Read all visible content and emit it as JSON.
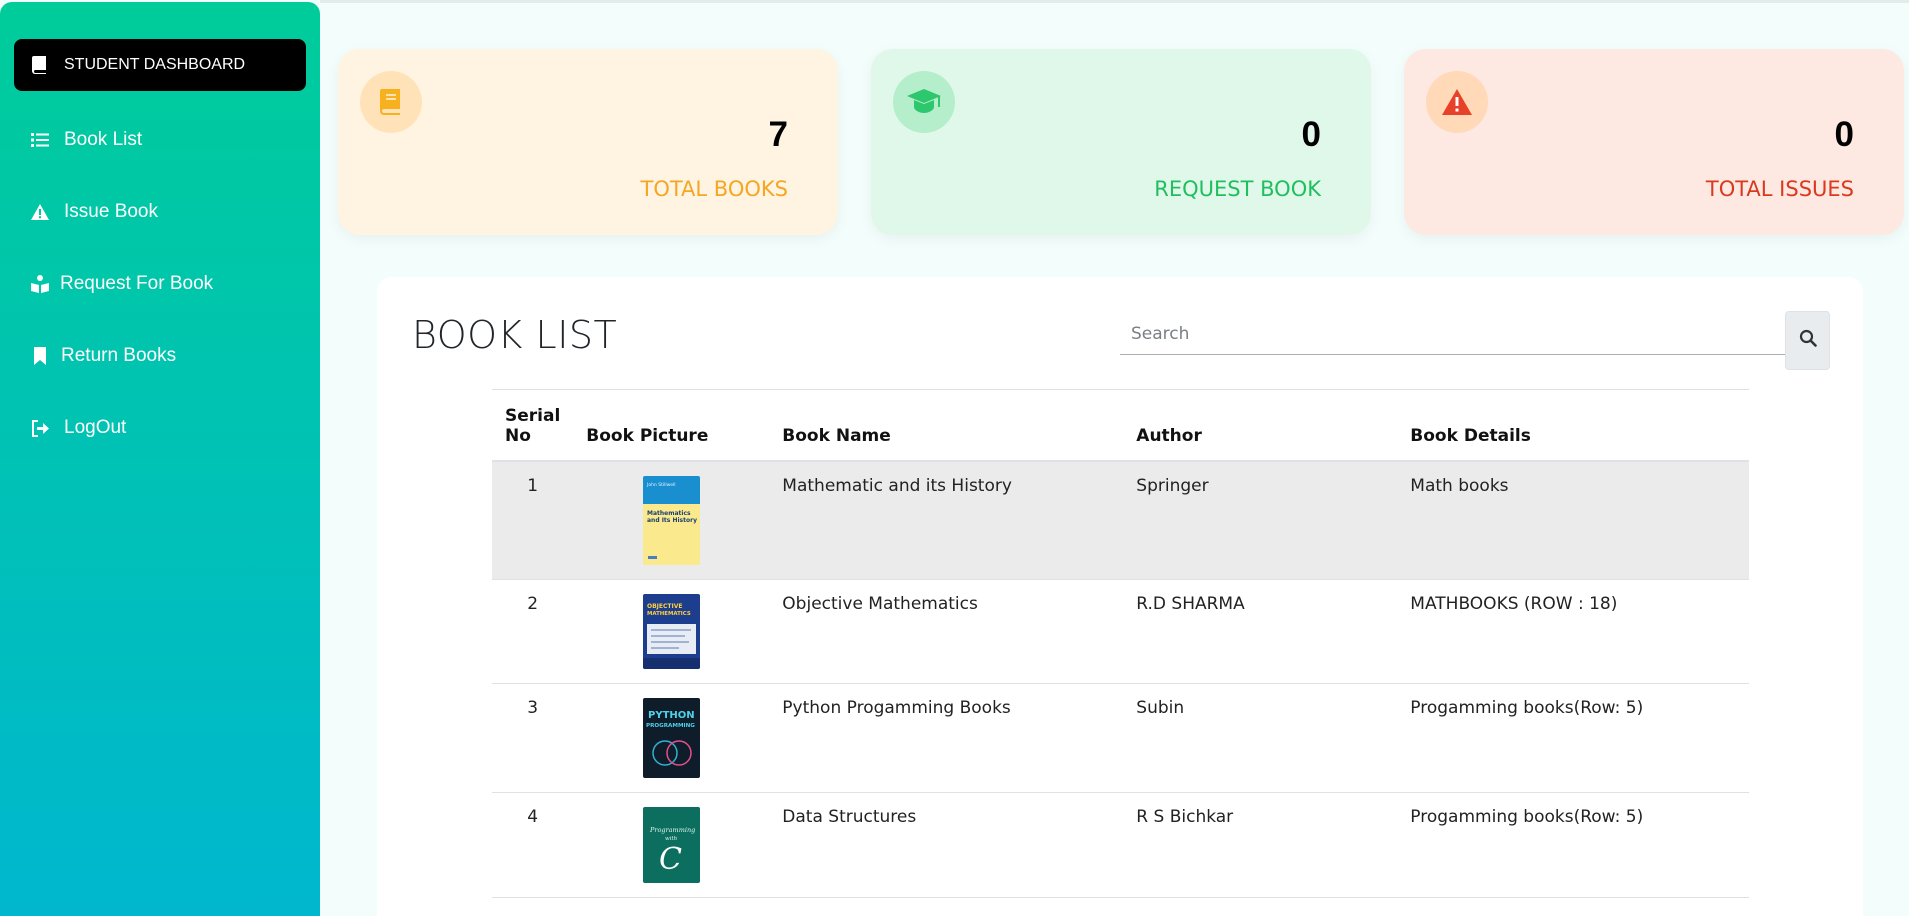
{
  "sidebar": {
    "dashboard_label": "STUDENT DASHBOARD",
    "items": [
      {
        "label": "Book List",
        "icon": "list-icon"
      },
      {
        "label": "Issue Book",
        "icon": "warning-icon"
      },
      {
        "label": "Request For Book",
        "icon": "reading-icon"
      },
      {
        "label": "Return Books",
        "icon": "bookmark-icon"
      },
      {
        "label": "LogOut",
        "icon": "sign-out-icon"
      }
    ]
  },
  "cards": [
    {
      "value": "7",
      "label": "TOTAL BOOKS",
      "icon": "book-icon",
      "bg": "#fff4e1",
      "accent": "#f7b11e",
      "label_color": "#f5a623"
    },
    {
      "value": "0",
      "label": "REQUEST BOOK",
      "icon": "graduation-cap-icon",
      "bg": "#e0f8ea",
      "accent": "#2dc76d",
      "label_color": "#1fbf5f"
    },
    {
      "value": "0",
      "label": "TOTAL ISSUES",
      "icon": "warning-icon",
      "bg": "#fde8e2",
      "accent": "#e8412a",
      "label_color": "#d93a1e"
    }
  ],
  "panel": {
    "title": "BOOK LIST",
    "search_placeholder": "Search",
    "columns": [
      "Serial No",
      "Book Picture",
      "Book Name",
      "Author",
      "Book Details"
    ],
    "rows": [
      {
        "serial": "1",
        "name": "Mathematic and its History",
        "author": "Springer",
        "details": "Math books",
        "cover": "math-history-cover"
      },
      {
        "serial": "2",
        "name": "Objective Mathematics",
        "author": "R.D SHARMA",
        "details": "MATHBOOKS (ROW : 18)",
        "cover": "objective-math-cover"
      },
      {
        "serial": "3",
        "name": "Python Progamming Books",
        "author": "Subin",
        "details": "Progamming books(Row: 5)",
        "cover": "python-cover"
      },
      {
        "serial": "4",
        "name": "Data Structures",
        "author": "R S Bichkar",
        "details": "Progamming books(Row: 5)",
        "cover": "c-programming-cover"
      }
    ],
    "cover_text": {
      "r1_author": "John Stillwell",
      "r1_title_1": "Mathematics",
      "r1_title_2": "and Its History",
      "r2_title_1": "OBJECTIVE",
      "r2_title_2": "MATHEMATICS",
      "r3_title_1": "PYTHON",
      "r3_title_2": "PROGRAMMING",
      "r4_title_1": "Programming",
      "r4_title_2": "with",
      "r4_title_3": "C"
    }
  }
}
